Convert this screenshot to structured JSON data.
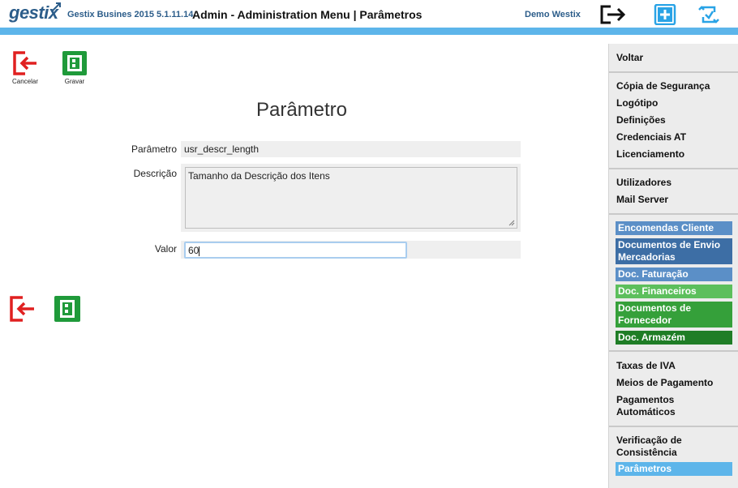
{
  "header": {
    "logo_text": "gestix",
    "app_name": "Gestix Busines 2015 5.1.11.14",
    "page_title": "Admin - Administration Menu | Parâmetros",
    "user_name": "Demo Westix",
    "icons": [
      "logout-icon",
      "add-icon",
      "refresh-icon"
    ]
  },
  "toolbar": {
    "cancel_label": "Cancelar",
    "save_label": "Gravar"
  },
  "form": {
    "title": "Parâmetro",
    "param_label": "Parâmetro",
    "param_value": "usr_descr_length",
    "desc_label": "Descrição",
    "desc_value": "Tamanho da Descrição dos Itens",
    "value_label": "Valor",
    "value_value": "60"
  },
  "sidebar": {
    "back": "Voltar",
    "group1": [
      "Cópia de Segurança",
      "Logótipo",
      "Definições",
      "Credenciais AT",
      "Licenciamento"
    ],
    "group2": [
      "Utilizadores",
      "Mail Server"
    ],
    "group3": [
      {
        "label": "Encomendas Cliente",
        "color": "#5b8fc7"
      },
      {
        "label": "Documentos de Envio Mercadorias",
        "color": "#3d6ea5"
      },
      {
        "label": "Doc. Faturação",
        "color": "#5b8fc7"
      },
      {
        "label": "Doc. Financeiros",
        "color": "#5cbf5c"
      },
      {
        "label": "Documentos de Fornecedor",
        "color": "#35a03a"
      },
      {
        "label": "Doc. Armazém",
        "color": "#1f7d26"
      }
    ],
    "group4": [
      "Taxas de IVA",
      "Meios de Pagamento",
      "Pagamentos Automáticos"
    ],
    "group5_item": "Verificação de Consistência",
    "active_item": {
      "label": "Parâmetros",
      "color": "#5db5ea"
    }
  }
}
